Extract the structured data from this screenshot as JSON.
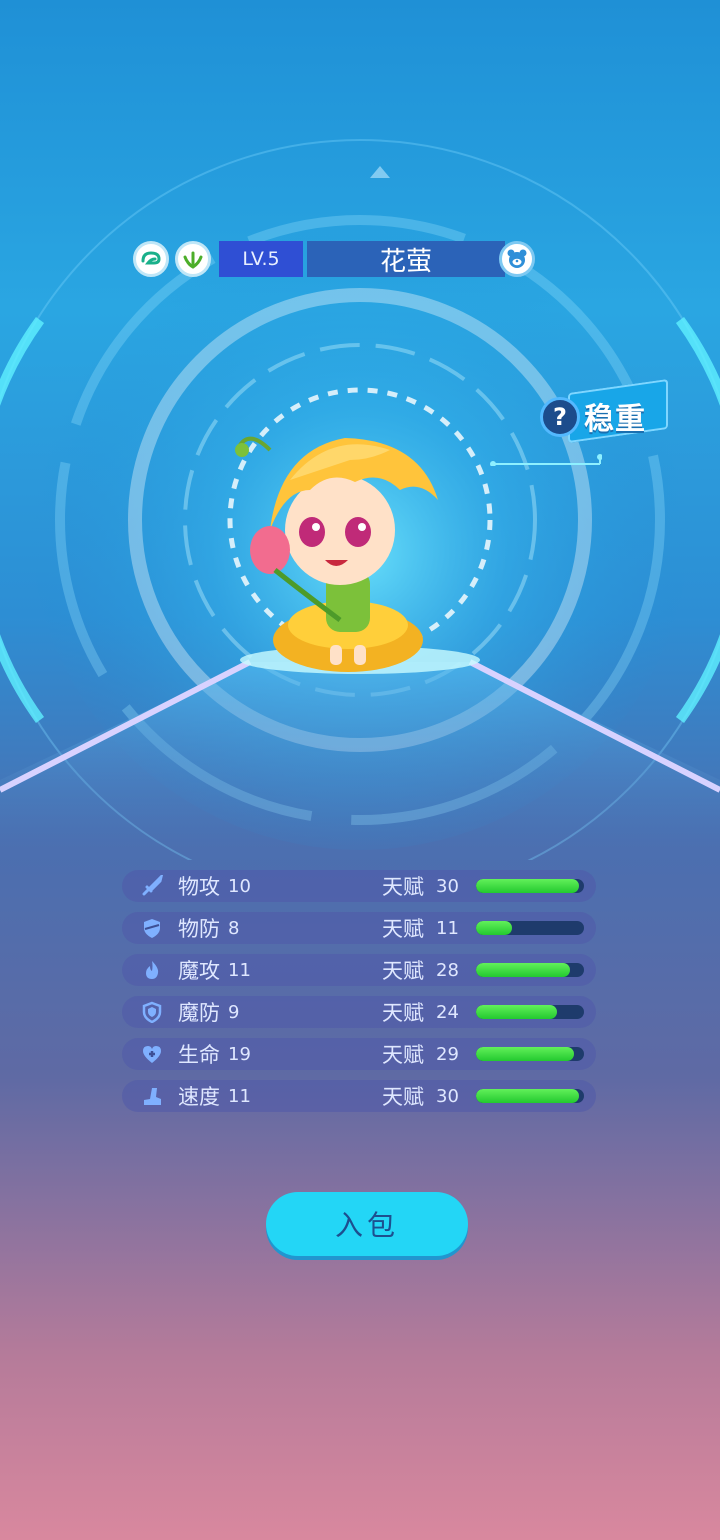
{
  "pet": {
    "level": "LV.5",
    "name": "花萤",
    "trait": "稳重",
    "trait_help": "?"
  },
  "icons": {
    "element_badge_1": "wind-icon",
    "element_badge_2": "grass-icon",
    "gender": "bear-face-icon"
  },
  "stats": [
    {
      "label": "物攻",
      "value": "10",
      "talent_label": "天赋",
      "talent": "30",
      "fill": 0.95,
      "icon": "sword-icon"
    },
    {
      "label": "物防",
      "value": "8",
      "talent_label": "天赋",
      "talent": "11",
      "fill": 0.33,
      "icon": "shield-slash-icon"
    },
    {
      "label": "魔攻",
      "value": "11",
      "talent_label": "天赋",
      "talent": "28",
      "fill": 0.87,
      "icon": "flame-icon"
    },
    {
      "label": "魔防",
      "value": "9",
      "talent_label": "天赋",
      "talent": "24",
      "fill": 0.75,
      "icon": "shield-icon"
    },
    {
      "label": "生命",
      "value": "19",
      "talent_label": "天赋",
      "talent": "29",
      "fill": 0.91,
      "icon": "heart-plus-icon"
    },
    {
      "label": "速度",
      "value": "11",
      "talent_label": "天赋",
      "talent": "30",
      "fill": 0.95,
      "icon": "boot-icon"
    }
  ],
  "actions": {
    "bag_button": "入包"
  },
  "colors": {
    "bar_fill": "#2ed23a",
    "bar_track": "#1e3b6c",
    "button": "#23d6f6",
    "level_box": "#2f4fd4",
    "name_box": "#2b63b8"
  }
}
